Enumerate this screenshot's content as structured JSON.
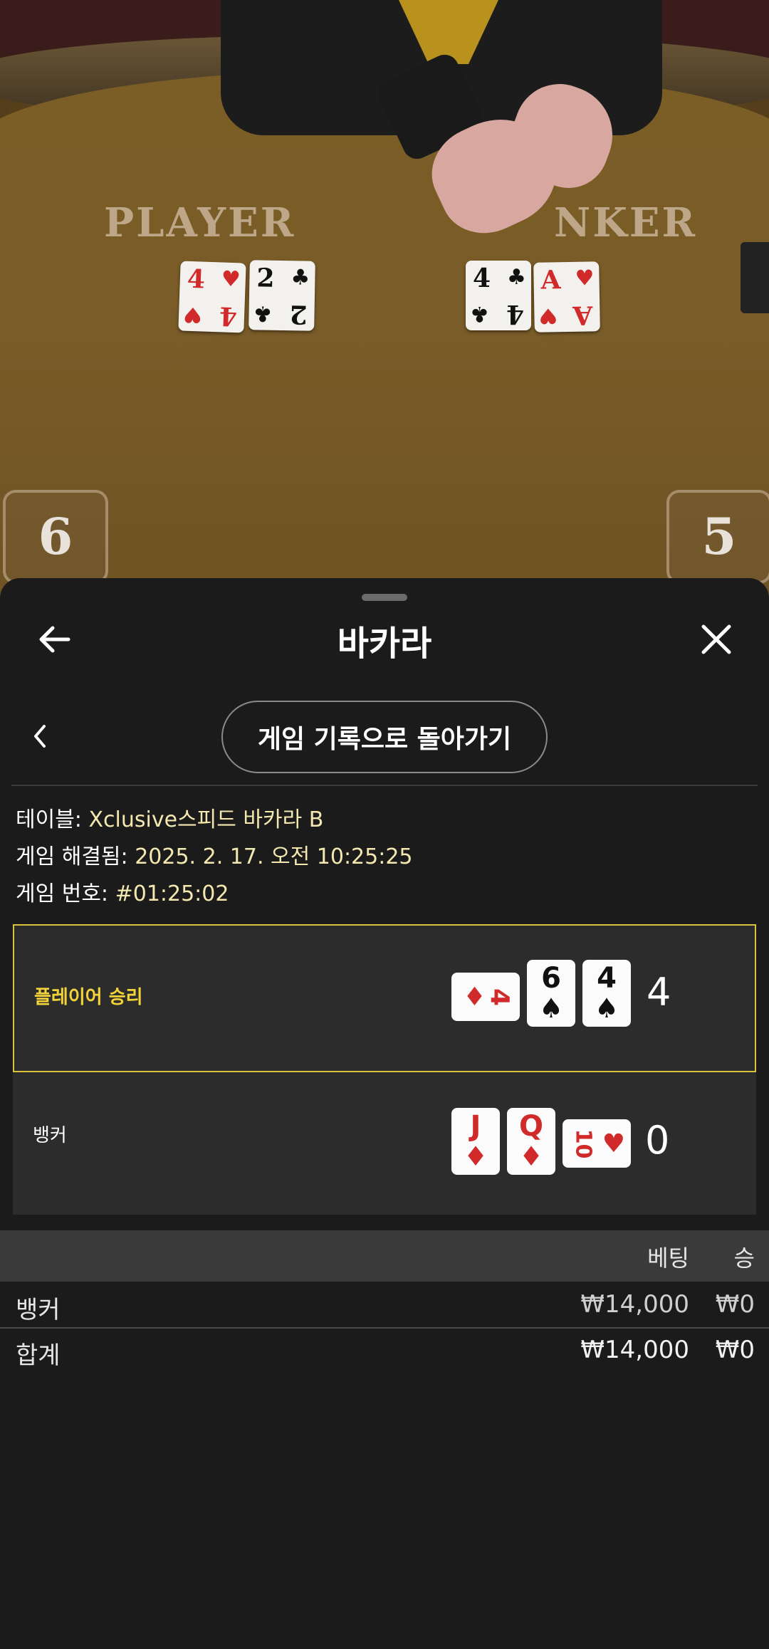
{
  "scene": {
    "player_label": "PLAYER",
    "banker_label": "NKER",
    "player_cards": [
      {
        "rank": "4",
        "suit": "♥",
        "color": "#d02a2a"
      },
      {
        "rank": "2",
        "suit": "♣",
        "color": "#111111"
      }
    ],
    "banker_cards": [
      {
        "rank": "4",
        "suit": "♣",
        "color": "#111111"
      },
      {
        "rank": "A",
        "suit": "♥",
        "color": "#d02a2a"
      }
    ],
    "player_score": "6",
    "banker_score": "5"
  },
  "sheet": {
    "back_icon": "arrow-left-icon",
    "close_icon": "close-icon",
    "title": "바카라",
    "prev_icon": "chevron-left-icon",
    "back_to_history": "게임 기록으로 돌아가기",
    "info": {
      "table_label": "테이블:",
      "table_value": "Xclusive스피드 바카라 B",
      "resolved_label": "게임 해결됨:",
      "resolved_value": "2025. 2. 17. 오전 10:25:25",
      "game_no_label": "게임 번호:",
      "game_no_value": "#01:25:02"
    },
    "results": {
      "player": {
        "label": "플레이어 승리",
        "score": "4",
        "cards": [
          {
            "rank": "4",
            "suit": "♦",
            "color": "#d02a2a",
            "orientation": "sideways"
          },
          {
            "rank": "6",
            "suit": "♠",
            "color": "#111111",
            "orientation": "upright"
          },
          {
            "rank": "4",
            "suit": "♠",
            "color": "#111111",
            "orientation": "upright"
          }
        ]
      },
      "banker": {
        "label": "뱅커",
        "score": "0",
        "cards": [
          {
            "rank": "J",
            "suit": "♦",
            "color": "#d02a2a",
            "orientation": "upright"
          },
          {
            "rank": "Q",
            "suit": "♦",
            "color": "#d02a2a",
            "orientation": "upright"
          },
          {
            "rank": "10",
            "suit": "♥",
            "color": "#d02a2a",
            "orientation": "sideways"
          }
        ]
      }
    },
    "table": {
      "headers": {
        "bet": "베팅",
        "win": "승"
      },
      "rows": [
        {
          "name": "뱅커",
          "bet": "₩14,000",
          "win": "₩0"
        },
        {
          "name": "합계",
          "bet": "₩14,000",
          "win": "₩0"
        }
      ]
    },
    "colors": {
      "win_border": "#d8c23a",
      "win_label": "#f2d43a",
      "info_value": "#f3e9b0"
    }
  }
}
